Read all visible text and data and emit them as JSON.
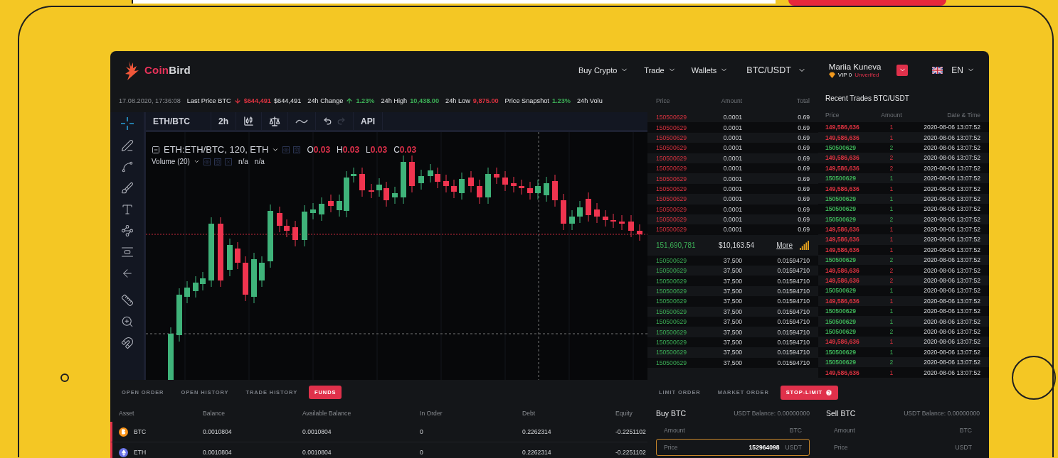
{
  "header": {
    "logo": {
      "part1": "Coin",
      "part2": "Bird"
    },
    "nav": [
      {
        "label": "Buy Crypto"
      },
      {
        "label": "Trade"
      },
      {
        "label": "Wallets"
      }
    ],
    "pair": "BTC/USDT",
    "user": {
      "name": "Mariia Kuneva",
      "level": "VIP 0",
      "status": "Unverifed"
    },
    "language": "EN"
  },
  "ticker": {
    "timestamp": "17.08.2020, 17:36:08",
    "items": [
      {
        "label": "Last Price BTC",
        "value": "$644,491",
        "color": "#d8323f",
        "arrow": true,
        "rising": false,
        "extra": "$644,491"
      },
      {
        "label": "24h Change",
        "value": "1.23%",
        "color": "#3cae56",
        "arrow": true,
        "rising": true
      },
      {
        "label": "24h High",
        "value": "10,438.00",
        "color": "#3cae56",
        "arrow": false
      },
      {
        "label": "24h Low",
        "value": "9,875.00",
        "color": "#d8323f",
        "arrow": false
      },
      {
        "label": "Price Snapshot",
        "value": "1.23%",
        "color": "#3cae56",
        "arrow": false
      },
      {
        "label": "24h Volu"
      }
    ]
  },
  "chart_toolbar": {
    "symbol": "ETH/BTC",
    "interval": "2h",
    "api": "API"
  },
  "chart_legend": {
    "title": "ETH:ETH/BTC, 120, ETH",
    "ohlc": [
      {
        "key": "O",
        "value": "0.03"
      },
      {
        "key": "H",
        "value": "0.03"
      },
      {
        "key": "L",
        "value": "0.03"
      },
      {
        "key": "C",
        "value": "0.03"
      }
    ],
    "volume": {
      "label": "Volume (20)",
      "values": [
        "n/a",
        "n/a"
      ]
    }
  },
  "order_book": {
    "columns": [
      "Price",
      "Amount",
      "Total"
    ],
    "asks": [
      {
        "price": "150500629",
        "amount": "0.0001",
        "total": "0.69"
      },
      {
        "price": "150500629",
        "amount": "0.0001",
        "total": "0.69"
      },
      {
        "price": "150500629",
        "amount": "0.0001",
        "total": "0.69"
      },
      {
        "price": "150500629",
        "amount": "0.0001",
        "total": "0.69"
      },
      {
        "price": "150500629",
        "amount": "0.0001",
        "total": "0.69"
      },
      {
        "price": "150500629",
        "amount": "0.0001",
        "total": "0.69"
      },
      {
        "price": "150500629",
        "amount": "0.0001",
        "total": "0.69"
      },
      {
        "price": "150500629",
        "amount": "0.0001",
        "total": "0.69"
      },
      {
        "price": "150500629",
        "amount": "0.0001",
        "total": "0.69"
      },
      {
        "price": "150500629",
        "amount": "0.0001",
        "total": "0.69"
      },
      {
        "price": "150500629",
        "amount": "0.0001",
        "total": "0.69"
      },
      {
        "price": "150500629",
        "amount": "0.0001",
        "total": "0.69"
      }
    ],
    "spread": {
      "price": "151,690,781",
      "usd": "$10,163.54",
      "link": "More"
    },
    "bids": [
      {
        "price": "150500629",
        "amount": "37,500",
        "total": "0.01594710"
      },
      {
        "price": "150500629",
        "amount": "37,500",
        "total": "0.01594710"
      },
      {
        "price": "150500629",
        "amount": "37,500",
        "total": "0.01594710"
      },
      {
        "price": "150500629",
        "amount": "37,500",
        "total": "0.01594710"
      },
      {
        "price": "150500629",
        "amount": "37,500",
        "total": "0.01594710"
      },
      {
        "price": "150500629",
        "amount": "37,500",
        "total": "0.01594710"
      },
      {
        "price": "150500629",
        "amount": "37,500",
        "total": "0.01594710"
      },
      {
        "price": "150500629",
        "amount": "37,500",
        "total": "0.01594710"
      },
      {
        "price": "150500629",
        "amount": "37,500",
        "total": "0.01594710"
      },
      {
        "price": "150500629",
        "amount": "37,500",
        "total": "0.01594710"
      },
      {
        "price": "150500629",
        "amount": "37,500",
        "total": "0.01594710"
      }
    ]
  },
  "recent_trades": {
    "title": "Recent Trades BTC/USDT",
    "columns": [
      "Price",
      "Amount",
      "Date & Time"
    ],
    "rows": [
      {
        "price": "149,586,636",
        "amount": "1",
        "time": "2020-08-06 13:07:52",
        "color": "#d8323f"
      },
      {
        "price": "149,586,636",
        "amount": "1",
        "time": "2020-08-06 13:07:52",
        "color": "#d8323f"
      },
      {
        "price": "150500629",
        "amount": "2",
        "time": "2020-08-06 13:07:52",
        "color": "#3cae56"
      },
      {
        "price": "149,586,636",
        "amount": "2",
        "time": "2020-08-06 13:07:52",
        "color": "#d8323f"
      },
      {
        "price": "149,586,636",
        "amount": "2",
        "time": "2020-08-06 13:07:52",
        "color": "#d8323f"
      },
      {
        "price": "150500629",
        "amount": "1",
        "time": "2020-08-06 13:07:52",
        "color": "#3cae56"
      },
      {
        "price": "149,586,636",
        "amount": "1",
        "time": "2020-08-06 13:07:52",
        "color": "#d8323f"
      },
      {
        "price": "150500629",
        "amount": "1",
        "time": "2020-08-06 13:07:52",
        "color": "#3cae56"
      },
      {
        "price": "150500629",
        "amount": "1",
        "time": "2020-08-06 13:07:52",
        "color": "#3cae56"
      },
      {
        "price": "150500629",
        "amount": "2",
        "time": "2020-08-06 13:07:52",
        "color": "#3cae56"
      },
      {
        "price": "149,586,636",
        "amount": "1",
        "time": "2020-08-06 13:07:52",
        "color": "#d8323f"
      },
      {
        "price": "149,586,636",
        "amount": "1",
        "time": "2020-08-06 13:07:52",
        "color": "#d8323f"
      },
      {
        "price": "149,586,636",
        "amount": "1",
        "time": "2020-08-06 13:07:52",
        "color": "#d8323f"
      },
      {
        "price": "150500629",
        "amount": "2",
        "time": "2020-08-06 13:07:52",
        "color": "#3cae56"
      },
      {
        "price": "149,586,636",
        "amount": "2",
        "time": "2020-08-06 13:07:52",
        "color": "#d8323f"
      },
      {
        "price": "149,586,636",
        "amount": "2",
        "time": "2020-08-06 13:07:52",
        "color": "#d8323f"
      },
      {
        "price": "150500629",
        "amount": "1",
        "time": "2020-08-06 13:07:52",
        "color": "#3cae56"
      },
      {
        "price": "149,586,636",
        "amount": "1",
        "time": "2020-08-06 13:07:52",
        "color": "#d8323f"
      },
      {
        "price": "150500629",
        "amount": "1",
        "time": "2020-08-06 13:07:52",
        "color": "#3cae56"
      },
      {
        "price": "150500629",
        "amount": "1",
        "time": "2020-08-06 13:07:52",
        "color": "#3cae56"
      },
      {
        "price": "150500629",
        "amount": "2",
        "time": "2020-08-06 13:07:52",
        "color": "#3cae56"
      },
      {
        "price": "149,586,636",
        "amount": "1",
        "time": "2020-08-06 13:07:52",
        "color": "#d8323f"
      },
      {
        "price": "150500629",
        "amount": "1",
        "time": "2020-08-06 13:07:52",
        "color": "#3cae56"
      },
      {
        "price": "150500629",
        "amount": "2",
        "time": "2020-08-06 13:07:52",
        "color": "#3cae56"
      },
      {
        "price": "149,586,636",
        "amount": "1",
        "time": "2020-08-06 13:07:52",
        "color": "#d8323f"
      }
    ]
  },
  "account_tabs": [
    {
      "label": "OPEN ORDER",
      "selected": false
    },
    {
      "label": "OPEN HISTORY",
      "selected": false
    },
    {
      "label": "TRADE HISTORY",
      "selected": false
    },
    {
      "label": "FUNDS",
      "selected": true
    }
  ],
  "funds_table": {
    "columns": [
      "Asset",
      "Balance",
      "Available Balance",
      "In Order",
      "Debt",
      "Equity"
    ],
    "rows": [
      {
        "kind": "btc",
        "asset": "BTC",
        "balance": "0.0010804",
        "available": "0.0010804",
        "in_order": "0",
        "debt": "0.2262314",
        "equity": "-0.2251102"
      },
      {
        "kind": "eth",
        "asset": "ETH",
        "balance": "0.0010804",
        "available": "0.0010804",
        "in_order": "0",
        "debt": "0.2262314",
        "equity": "-0.2251102"
      }
    ]
  },
  "order_tabs": [
    {
      "label": "LIMIT ORDER",
      "selected": false
    },
    {
      "label": "MARKET ORDER",
      "selected": false
    },
    {
      "label": "STOP-LIMIT",
      "selected": true
    }
  ],
  "order_forms": [
    {
      "title": "Buy BTC",
      "balance": "USDT Balance: 0.00000000",
      "amount_label": "Amount",
      "amount_unit": "BTC",
      "price_label": "Price",
      "price_value": "152964098",
      "price_unit": "USDT",
      "focused": true
    },
    {
      "title": "Sell BTC",
      "balance": "USDT Balance: 0.00000000",
      "amount_label": "Amount",
      "amount_unit": "BTC",
      "price_label": "Price",
      "price_unit": "USDT",
      "focused": false
    }
  ]
}
